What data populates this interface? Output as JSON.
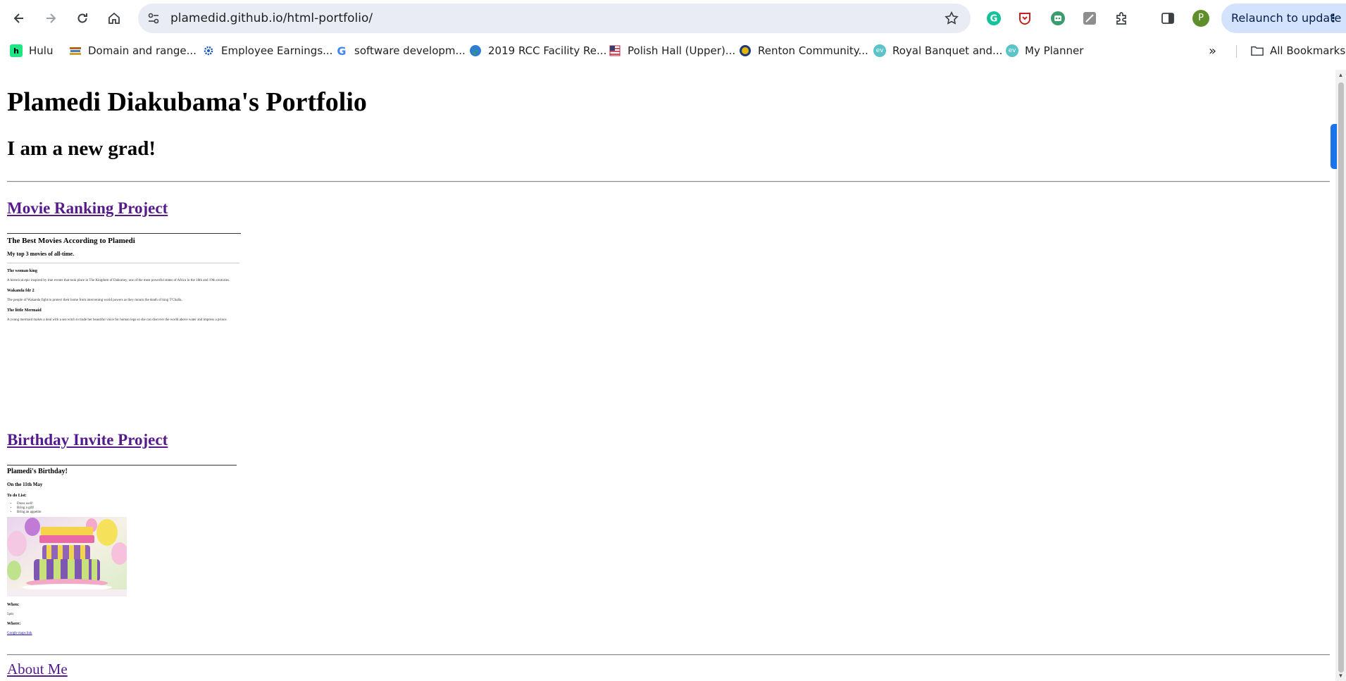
{
  "browser": {
    "url": "plamedid.github.io/html-portfolio/",
    "relaunch_label": "Relaunch to update",
    "profile_initial": "P",
    "bookmarks": [
      {
        "label": "Hulu",
        "icon": "hulu-icon"
      },
      {
        "label": "Domain and range...",
        "icon": "books-icon"
      },
      {
        "label": "Employee Earnings...",
        "icon": "gear-icon"
      },
      {
        "label": "software developm...",
        "icon": "google-icon"
      },
      {
        "label": "2019 RCC Facility Re...",
        "icon": "globe-icon"
      },
      {
        "label": "Polish Hall (Upper)...",
        "icon": "flag-icon"
      },
      {
        "label": "Renton Community...",
        "icon": "seal-icon"
      },
      {
        "label": "Royal Banquet and...",
        "icon": "ev-icon"
      },
      {
        "label": "My Planner",
        "icon": "ev-icon"
      }
    ],
    "all_bookmarks_label": "All Bookmarks"
  },
  "page": {
    "title": "Plamedi Diakubama's Portfolio",
    "subtitle": "I am a new grad!",
    "projects": [
      {
        "link": "Movie Ranking Project",
        "heading": "The Best Movies According to Plamedi",
        "subheading": "My top 3 movies of all-time.",
        "movies": [
          {
            "title": "The woman king",
            "desc": "A historical epic inspired by true events that took place in The Kingdom of Dahomey, one of the most powerful states of Africa in the 18th and 19th centuries."
          },
          {
            "title": "Wakanda fdr 2",
            "desc": "The people of Wakanda fight to protect their home from intervening world powers as they mourn the death of king T'Challa."
          },
          {
            "title": "The little Mermaid",
            "desc": "A young mermaid makes a deal with a sea witch to trade her beautiful voice for human legs so she can discover the world above water and impress a prince."
          }
        ]
      },
      {
        "link": "Birthday Invite Project",
        "heading": "Plamedi's Birthday!",
        "date": "On the 11th May",
        "todo_label": "To do List:",
        "todo_items": [
          "Dress well!",
          "Bring a gift!",
          "Bring an appetite"
        ],
        "when_label": "When:",
        "when_value": "5pm",
        "where_label": "Where:",
        "where_link": "Google maps link"
      }
    ],
    "about_link": "About Me"
  }
}
